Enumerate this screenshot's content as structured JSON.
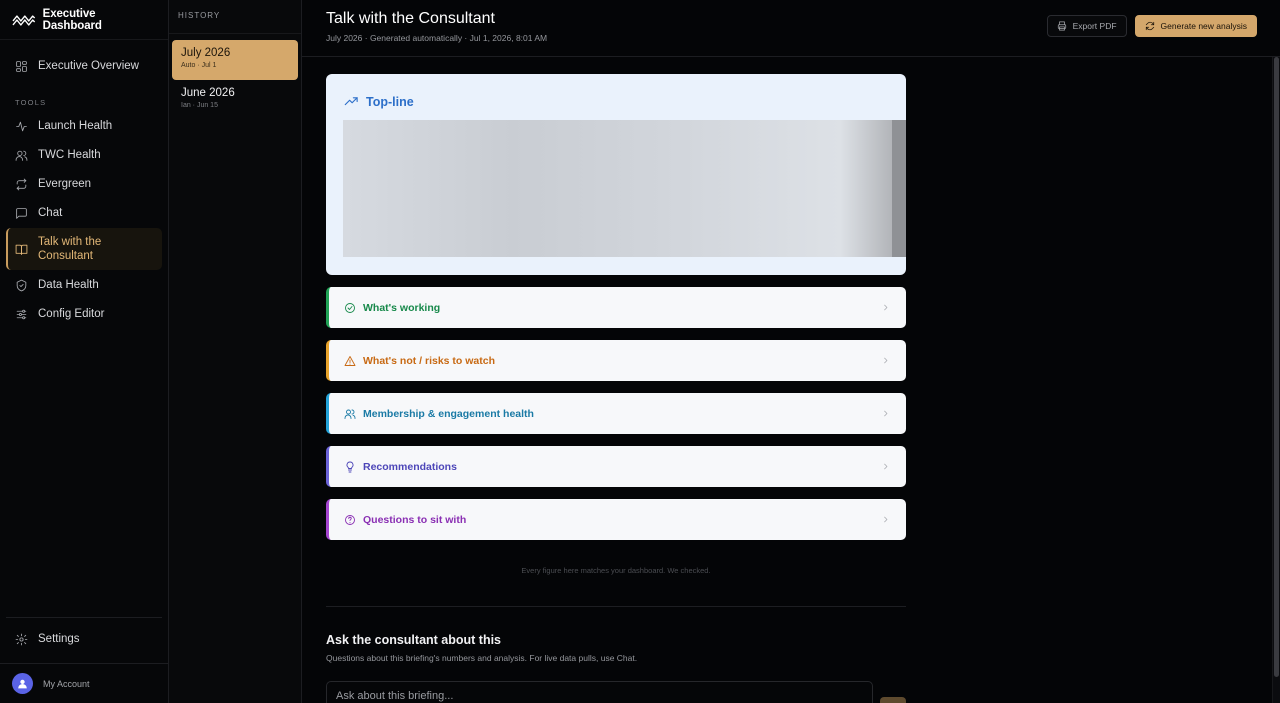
{
  "brand": {
    "title": "Executive Dashboard"
  },
  "nav": {
    "overview": "Executive Overview",
    "section_label": "TOOLS",
    "items": [
      {
        "label": "Launch Health",
        "icon": "activity-icon"
      },
      {
        "label": "TWC Health",
        "icon": "users-icon"
      },
      {
        "label": "Evergreen",
        "icon": "repeat-icon"
      },
      {
        "label": "Chat",
        "icon": "chat-icon"
      },
      {
        "label": "Talk with the Consultant",
        "icon": "book-icon"
      },
      {
        "label": "Data Health",
        "icon": "shield-icon"
      },
      {
        "label": "Config Editor",
        "icon": "sliders-icon"
      }
    ],
    "settings": "Settings",
    "account": "My Account"
  },
  "history": {
    "header": "HISTORY",
    "items": [
      {
        "title": "July 2026",
        "meta": "Auto · Jul 1"
      },
      {
        "title": "June 2026",
        "meta": "Ian · Jun 15"
      }
    ]
  },
  "header": {
    "title": "Talk with the Consultant",
    "subtitle": "July 2026 · Generated automatically · Jul 1, 2026, 8:01 AM",
    "export_label": "Export PDF",
    "generate_label": "Generate new analysis"
  },
  "topline": {
    "title": "Top-line"
  },
  "sections": [
    {
      "label": "What's working",
      "icon": "check-circle-icon"
    },
    {
      "label": "What's not / risks to watch",
      "icon": "warning-icon"
    },
    {
      "label": "Membership & engagement health",
      "icon": "users-icon"
    },
    {
      "label": "Recommendations",
      "icon": "lightbulb-icon"
    },
    {
      "label": "Questions to sit with",
      "icon": "question-circle-icon"
    }
  ],
  "footnote": "Every figure here matches your dashboard. We checked.",
  "ask": {
    "title": "Ask the consultant about this",
    "subtitle": "Questions about this briefing's numbers and analysis. For live data pulls, use Chat.",
    "placeholder": "Ask about this briefing..."
  },
  "colors": {
    "accent": "#d4a76b",
    "working": "#21a356",
    "risks": "#e8a32b",
    "membership": "#23a3d9",
    "recommendations": "#6b63d8",
    "questions": "#a545d0"
  }
}
